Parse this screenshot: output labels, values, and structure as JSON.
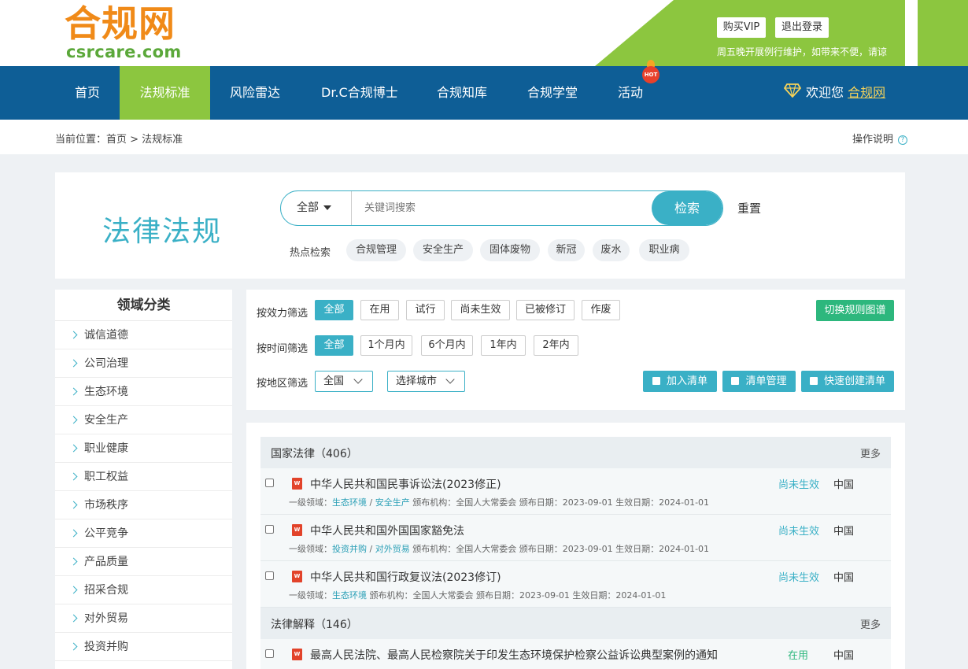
{
  "header": {
    "logo_cn": "合规网",
    "logo_en": "csrcare.com",
    "buy_vip": "购买VIP",
    "logout": "退出登录",
    "notice": "周五晚开展例行维护，如带来不便，请谅"
  },
  "nav": {
    "items": [
      "首页",
      "法规标准",
      "风险雷达",
      "Dr.C合规博士",
      "合规知库",
      "合规学堂",
      "活动"
    ],
    "active_index": 1,
    "hot_badge": "HOT",
    "welcome": "欢迎您",
    "username": "合规网"
  },
  "breadcrumb": {
    "text": "当前位置：首页 > 法规标准",
    "help": "操作说明"
  },
  "search": {
    "title": "法律法规",
    "scope": "全部",
    "placeholder": "关键词搜索",
    "button": "检索",
    "reset": "重置",
    "hot_label": "热点检索",
    "hot_tags": [
      "合规管理",
      "安全生产",
      "固体废物",
      "新冠",
      "废水",
      "职业病"
    ]
  },
  "sidebar": {
    "title": "领域分类",
    "items": [
      "诚信道德",
      "公司治理",
      "生态环境",
      "安全生产",
      "职业健康",
      "职工权益",
      "市场秩序",
      "公平竞争",
      "产品质量",
      "招采合规",
      "对外贸易",
      "投资并购"
    ]
  },
  "filters": {
    "validity_label": "按效力筛选",
    "validity_options": [
      "全部",
      "在用",
      "试行",
      "尚未生效",
      "已被修订",
      "作废"
    ],
    "time_label": "按时间筛选",
    "time_options": [
      "全部",
      "1个月内",
      "6个月内",
      "1年内",
      "2年内"
    ],
    "region_label": "按地区筛选",
    "region_value": "全国",
    "city_placeholder": "选择城市",
    "switch_graph": "切换规则图谱",
    "add_list": "加入清单",
    "manage_list": "清单管理",
    "quick_create": "快速创建清单"
  },
  "results": {
    "more": "更多",
    "sections": [
      {
        "title": "国家法律（406）",
        "rows": [
          {
            "title": "中华人民共和国民事诉讼法(2023修正)",
            "meta_prefix": "一级领域：",
            "tags": [
              "生态环境",
              "安全生产"
            ],
            "meta_rest": " 颁布机构：全国人大常委会 颁布日期：2023-09-01 生效日期：2024-01-01",
            "status": "尚未生效",
            "region": "中国"
          },
          {
            "title": "中华人民共和国外国国家豁免法",
            "meta_prefix": "一级领域：",
            "tags": [
              "投资并购",
              "对外贸易"
            ],
            "meta_rest": " 颁布机构：全国人大常委会 颁布日期：2023-09-01 生效日期：2024-01-01",
            "status": "尚未生效",
            "region": "中国"
          },
          {
            "title": "中华人民共和国行政复议法(2023修订)",
            "meta_prefix": "一级领域：",
            "tags": [
              "生态环境"
            ],
            "meta_rest": " 颁布机构：全国人大常委会 颁布日期：2023-09-01 生效日期：2024-01-01",
            "status": "尚未生效",
            "region": "中国"
          }
        ]
      },
      {
        "title": "法律解释（146）",
        "rows": [
          {
            "title": "最高人民法院、最高人民检察院关于印发生态环境保护检察公益诉讼典型案例的通知",
            "status": "在用",
            "region": "中国"
          }
        ]
      }
    ]
  },
  "colors": {
    "nav_blue": "#0e5e96",
    "brand_green": "#8cc63f",
    "accent_teal": "#3ab0c6",
    "logo_orange": "#f08a18",
    "status_pending": "#3ab0c6",
    "status_active": "#2db77d"
  }
}
